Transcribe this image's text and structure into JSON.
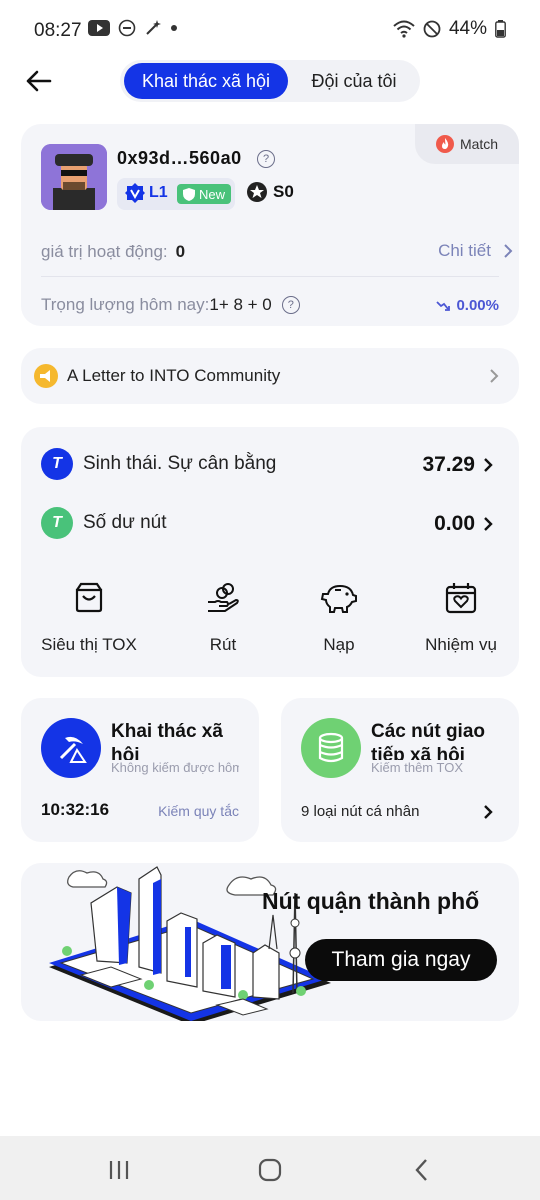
{
  "status_bar": {
    "time": "08:27",
    "battery": "44%"
  },
  "header": {
    "tab_active": "Khai thác xã hội",
    "tab_inactive": "Đội của tôi"
  },
  "profile": {
    "address": "0x93d…560a0",
    "level": "L1",
    "new_badge": "New",
    "so_label": "S0",
    "match_label": "Match",
    "activity_label": "giá trị hoạt động:",
    "activity_value": "0",
    "detail_link": "Chi tiết",
    "weight_label": "Trọng lượng hôm nay:",
    "weight_value": "1+ 8 + 0",
    "weight_change": "0.00%"
  },
  "announcement": {
    "text": "A Letter to INTO Community"
  },
  "balances": {
    "eco_label": "Sinh thái. Sự cân bằng",
    "eco_value": "37.29",
    "node_label": "Số dư nút",
    "node_value": "0.00"
  },
  "actions": [
    {
      "label": "Siêu thị TOX",
      "icon": "cart-icon"
    },
    {
      "label": "Rút",
      "icon": "withdraw-hand-icon"
    },
    {
      "label": "Nạp",
      "icon": "piggy-bank-icon"
    },
    {
      "label": "Nhiệm vụ",
      "icon": "calendar-heart-icon"
    }
  ],
  "mining": {
    "title": "Khai thác xã hội",
    "subtitle": "Không kiếm được hôm nay",
    "timer": "10:32:16",
    "rules_link": "Kiếm quy tắc"
  },
  "nodes": {
    "title": "Các nút giao tiếp xã hội",
    "subtitle": "Kiếm thêm TOX",
    "info": "9 loại nút cá nhân"
  },
  "city": {
    "title": "Nút quận thành phố",
    "join_label": "Tham gia ngay"
  },
  "colors": {
    "primary": "#1434e6",
    "green": "#49c27a",
    "card": "#f4f5f9"
  }
}
